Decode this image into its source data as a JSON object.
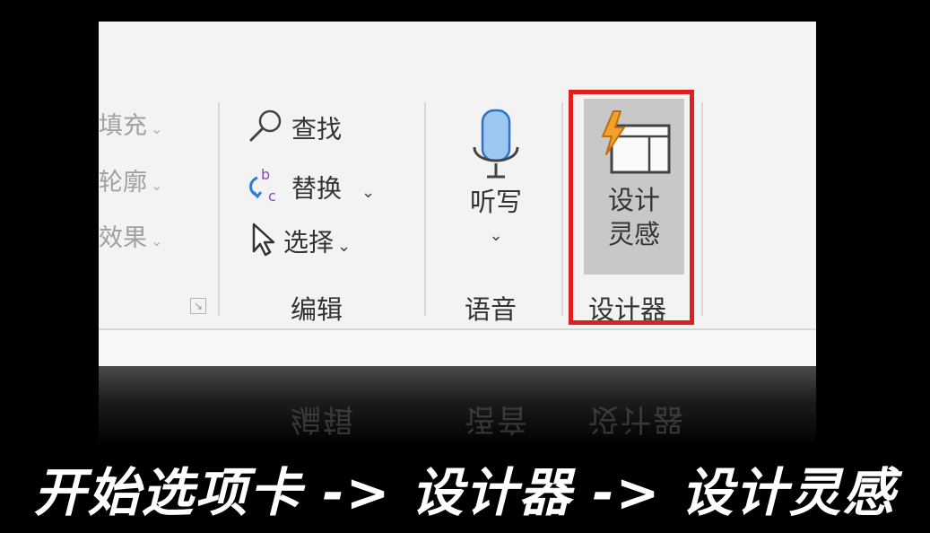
{
  "ribbon": {
    "shape_group": {
      "items": [
        "填充",
        "轮廓",
        "效果"
      ]
    },
    "editing_group": {
      "label": "编辑",
      "find_label": "查找",
      "replace_label": "替换",
      "select_label": "选择"
    },
    "voice_group": {
      "label": "语音",
      "dictate_label": "听写"
    },
    "designer_group": {
      "label": "设计器",
      "design_ideas_line1": "设计",
      "design_ideas_line2": "灵感"
    },
    "highlight_color": "#e02020"
  },
  "caption": {
    "text": "开始选项卡 -> 设计器 -> 设计灵感"
  }
}
